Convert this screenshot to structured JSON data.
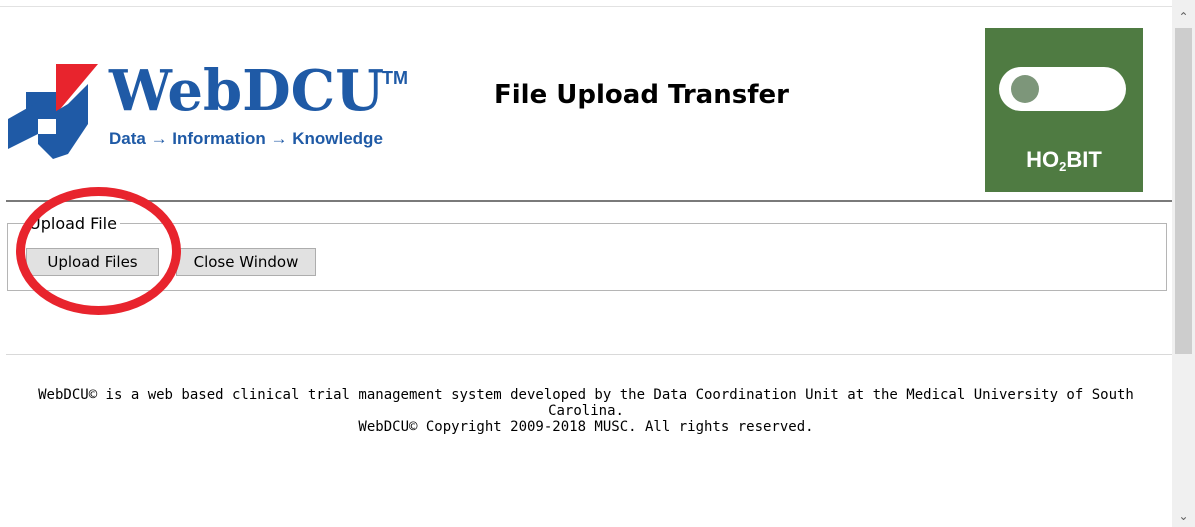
{
  "header": {
    "logo": {
      "wordmark": "WebDCU",
      "trademark": "TM",
      "tagline": "Data → Information → Knowledge"
    },
    "title": "File Upload Transfer",
    "badge": {
      "brand": "HO",
      "brand_sub": "2",
      "brand_suffix": "BIT",
      "color": "#4f7b42",
      "icon": "toggle-switch-icon"
    }
  },
  "upload": {
    "legend": "Upload File",
    "upload_button": "Upload Files",
    "close_button": "Close Window"
  },
  "footer": {
    "line1": "WebDCU© is a web based clinical trial management system developed by the Data Coordination Unit at the Medical University of South Carolina.",
    "line2": "WebDCU© Copyright 2009-2018 MUSC. All rights reserved."
  },
  "annotation": {
    "color": "#e8242d"
  },
  "scrollbar": {
    "up_icon": "scroll-up-arrow-icon",
    "down_icon": "scroll-down-arrow-icon"
  }
}
